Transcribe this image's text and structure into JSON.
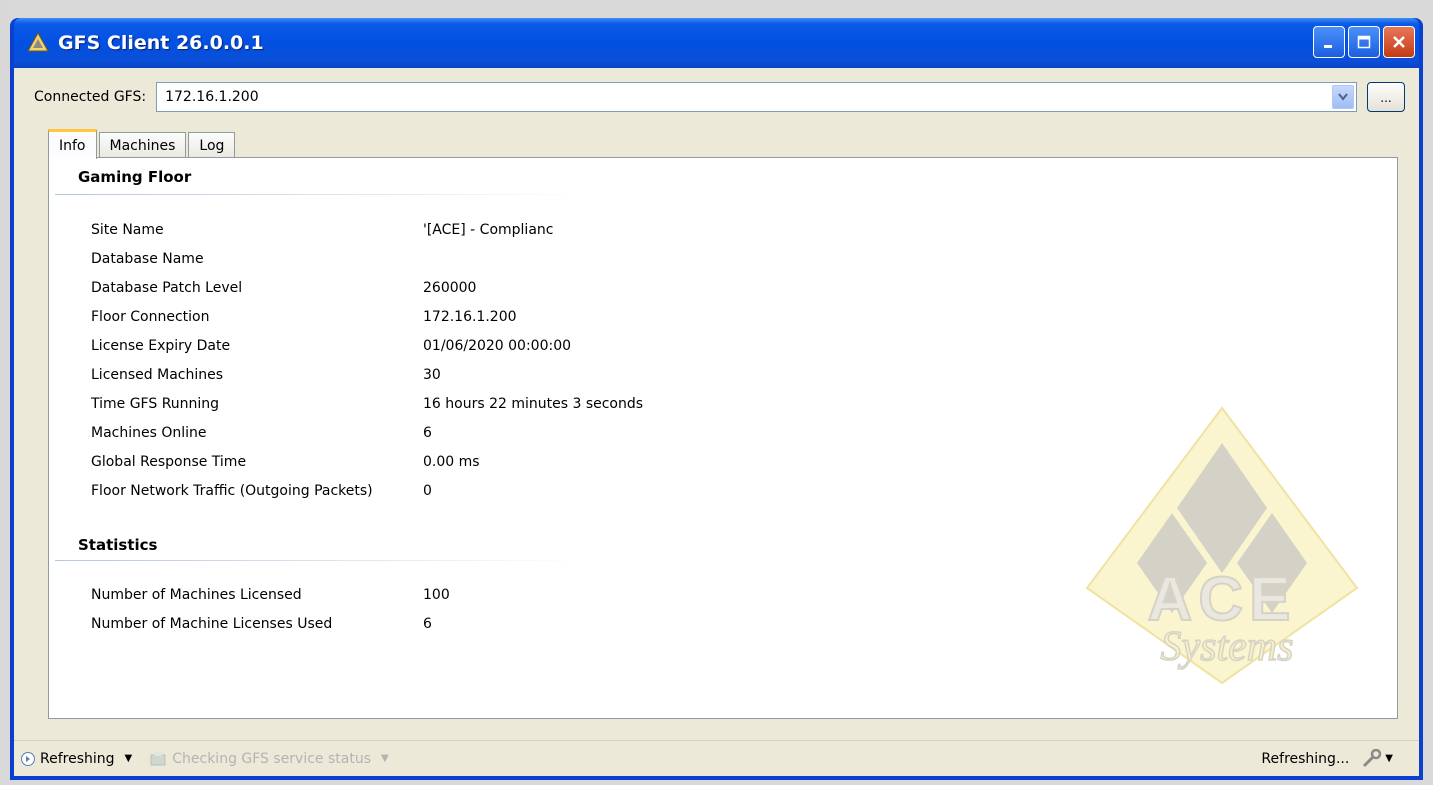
{
  "window": {
    "title": "GFS Client 26.0.0.1"
  },
  "connection": {
    "label": "Connected GFS:",
    "value": "172.16.1.200",
    "browse_label": "..."
  },
  "tabs": [
    {
      "label": "Info"
    },
    {
      "label": "Machines"
    },
    {
      "label": "Log"
    }
  ],
  "gaming_floor": {
    "title": "Gaming Floor",
    "rows": [
      {
        "key": "Site Name",
        "value": "'[ACE] - Complianc"
      },
      {
        "key": "Database Name",
        "value": ""
      },
      {
        "key": "Database Patch Level",
        "value": "260000"
      },
      {
        "key": "Floor Connection",
        "value": "172.16.1.200"
      },
      {
        "key": "License Expiry Date",
        "value": "01/06/2020 00:00:00"
      },
      {
        "key": "Licensed Machines",
        "value": "30"
      },
      {
        "key": "Time GFS Running",
        "value": "16 hours 22 minutes 3 seconds"
      },
      {
        "key": "Machines Online",
        "value": "6"
      },
      {
        "key": "Global Response Time",
        "value": "0.00 ms"
      },
      {
        "key": "Floor Network Traffic (Outgoing Packets)",
        "value": "0"
      }
    ]
  },
  "statistics": {
    "title": "Statistics",
    "rows": [
      {
        "key": "Number of Machines Licensed",
        "value": "100"
      },
      {
        "key": "Number of Machine Licenses Used",
        "value": "6"
      }
    ]
  },
  "watermark": {
    "logo_text": "ACE",
    "logo_script": "Systems"
  },
  "statusbar": {
    "refresh_label": "Refreshing",
    "checking_label": "Checking GFS service status",
    "right_label": "Refreshing..."
  },
  "colors": {
    "titlebar": "#0250e2",
    "client_bg": "#ece9d8",
    "tab_highlight": "#ffc83c",
    "watermark_gold": "#f3e9a8"
  }
}
